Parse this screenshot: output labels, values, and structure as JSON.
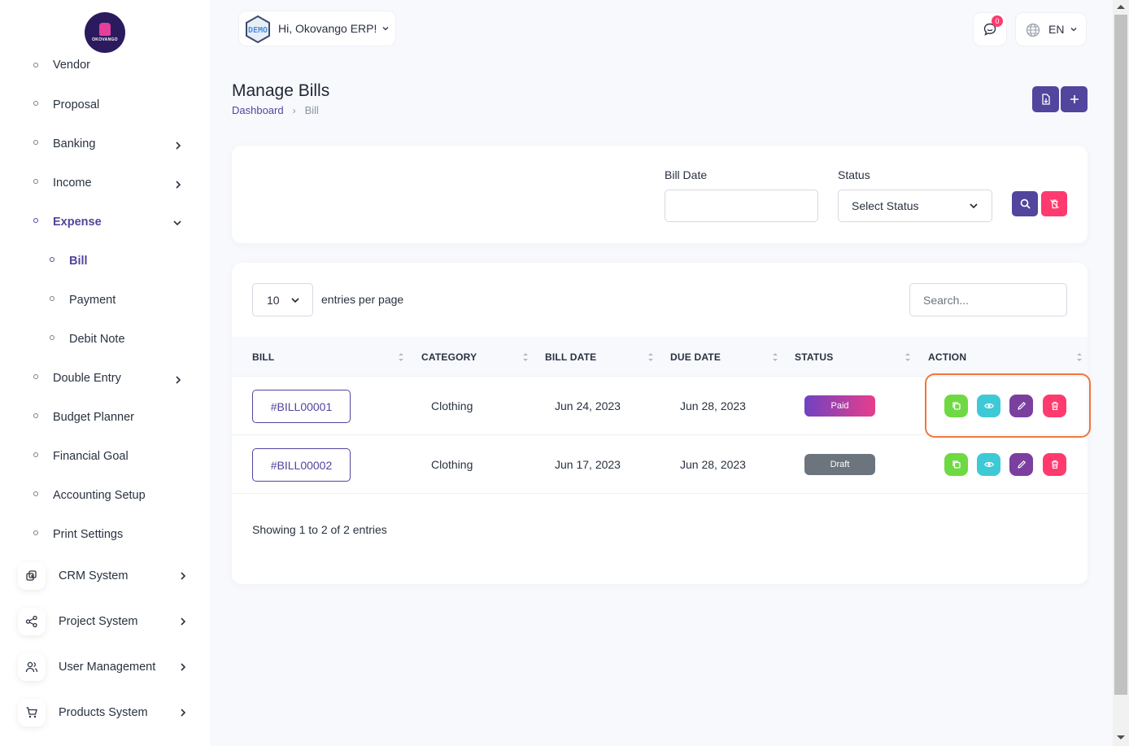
{
  "brand": {
    "logo_text": "OKOVANGO"
  },
  "sidebar": {
    "items": [
      {
        "label": "Vendor"
      },
      {
        "label": "Proposal"
      },
      {
        "label": "Banking"
      },
      {
        "label": "Income"
      },
      {
        "label": "Expense"
      },
      {
        "label": "Bill"
      },
      {
        "label": "Payment"
      },
      {
        "label": "Debit Note"
      },
      {
        "label": "Double Entry"
      },
      {
        "label": "Budget Planner"
      },
      {
        "label": "Financial Goal"
      },
      {
        "label": "Accounting Setup"
      },
      {
        "label": "Print Settings"
      }
    ],
    "sections": [
      {
        "label": "CRM System",
        "icon": "layers-icon"
      },
      {
        "label": "Project System",
        "icon": "share-icon"
      },
      {
        "label": "User Management",
        "icon": "users-icon"
      },
      {
        "label": "Products System",
        "icon": "cart-icon"
      }
    ]
  },
  "topbar": {
    "avatar_text": "DEMO",
    "greeting": "Hi, Okovango ERP!",
    "notification_count": "0",
    "language": "EN"
  },
  "page": {
    "title": "Manage Bills",
    "breadcrumb": [
      "Dashboard",
      "Bill"
    ]
  },
  "filters": {
    "bill_date_label": "Bill Date",
    "bill_date_value": "",
    "status_label": "Status",
    "status_value": "Select Status"
  },
  "table": {
    "per_page": "10",
    "per_page_label": "entries per page",
    "search_placeholder": "Search...",
    "columns": [
      "BILL",
      "CATEGORY",
      "BILL DATE",
      "DUE DATE",
      "STATUS",
      "ACTION"
    ],
    "rows": [
      {
        "bill": "#BILL00001",
        "category": "Clothing",
        "bill_date": "Jun 24, 2023",
        "due_date": "Jun 28, 2023",
        "status": "Paid"
      },
      {
        "bill": "#BILL00002",
        "category": "Clothing",
        "bill_date": "Jun 17, 2023",
        "due_date": "Jun 28, 2023",
        "status": "Draft"
      }
    ],
    "footer": "Showing 1 to 2 of 2 entries"
  },
  "colors": {
    "primary": "#51459d",
    "paid_gradient": [
      "#6f42c1",
      "#e83e8c"
    ],
    "draft": "#6c757d",
    "copy": "#6fd943",
    "view": "#3ec9d6",
    "edit": "#7b3fa0",
    "delete": "#ff3a6e",
    "highlight": "#f0773c"
  }
}
